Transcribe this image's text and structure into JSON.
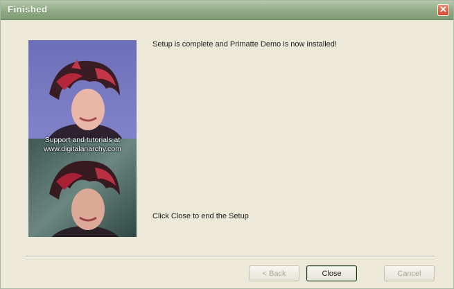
{
  "window": {
    "title": "Finished",
    "close_glyph": "✕"
  },
  "sidebar_image": {
    "caption_line1": "Support and tutorials at",
    "caption_line2": "www.digitalanarchy.com"
  },
  "messages": {
    "complete": "Setup is complete and Primatte Demo is now installed!",
    "instruction": "Click Close to end the Setup"
  },
  "buttons": {
    "back": "< Back",
    "close": "Close",
    "cancel": "Cancel"
  },
  "colors": {
    "titlebar": "#8fa985",
    "close_button": "#d2462a",
    "dialog_bg": "#ece9d8"
  }
}
